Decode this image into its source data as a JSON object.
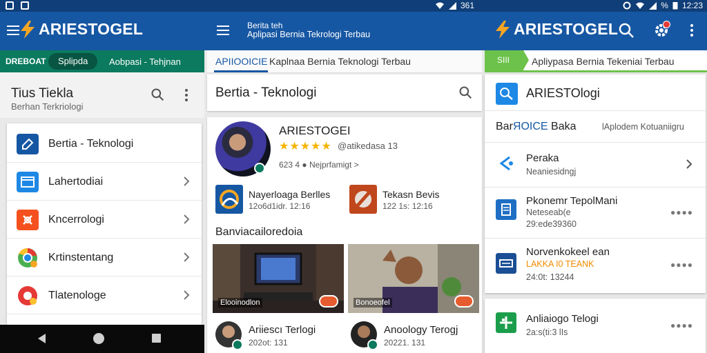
{
  "status": {
    "mid_text": "361",
    "right_text": "%",
    "time": "12:23"
  },
  "appbar": {
    "logo_left": "ARIESTOGEL",
    "logo_right": "ARIESTOGEL",
    "center_line1": "Berita teh",
    "center_line2": "Aplipasi Bernia Tekrologi Terbau"
  },
  "panel1": {
    "chips": [
      "DREBOAT",
      "Splipda",
      "Aobpasi - Tehjnan"
    ],
    "header_title": "Tius Tiekla",
    "header_subtitle": "Berhan Terkriologi",
    "items": [
      {
        "label": "Bertia - Teknologi",
        "icon": "edit-icon",
        "color": "#1657a3"
      },
      {
        "label": "Lahertodiai",
        "icon": "window-icon",
        "color": "#1e88e5"
      },
      {
        "label": "Kncerrologi",
        "icon": "tools-icon",
        "color": "#f4511e"
      },
      {
        "label": "Krtinstentang",
        "icon": "chrome-icon",
        "color": "#4caf50"
      },
      {
        "label": "Tlatenologe",
        "icon": "record-icon",
        "color": "#e53935"
      }
    ]
  },
  "panel2": {
    "tabs": [
      "APIIOOICIE",
      "Kaplnaa Bernia Teknologi Terbau"
    ],
    "search_title": "Bertia - Teknologi",
    "profile": {
      "name": "ARIESTOGEI",
      "rating_stars": "★★★★★",
      "rating": 5,
      "handle": "@atikedasa 13",
      "stats": "623 4 ● Nejprfamigt >"
    },
    "mini_items": [
      {
        "title": "Nayerloaga Berlles",
        "date": "12o6d1idr. 12:16"
      },
      {
        "title": "Tekasn Bevis",
        "date": "122 1s: 12:16"
      }
    ],
    "section_title": "Banviacailoredoia",
    "videos": [
      {
        "label": "Elooinodlon",
        "author": "Ariiescı Terlogi",
        "date": "202ot: 131"
      },
      {
        "label": "Bonoeofel",
        "author": "Anoology Terogj",
        "date": "20221. 131"
      }
    ]
  },
  "panel3": {
    "chips": [
      "SIII",
      "Apliypasa Bernia Tekeniai Terbau"
    ],
    "head_title": "ARIESTOlogi",
    "sub_left_a": "Bar",
    "sub_left_b": "ЯOICE",
    "sub_left_c": " Baka",
    "sub_right": "lAplodem Kotuaniigru",
    "items": [
      {
        "title": "Peraka",
        "desc": "Neaniesidngj",
        "extra": ""
      },
      {
        "title": "Pkonemr TepolMani",
        "desc": "Neteseab(e",
        "extra": "29:ede39360"
      },
      {
        "title": "Norvenkokeel ean",
        "desc": "LAKKA I0 TEANK",
        "extra": "24:0t: 13244"
      },
      {
        "title": "Anliaiogo Telogi",
        "desc": "2a:s(ti:3 lIs",
        "extra": ""
      }
    ],
    "dots": "●●●●"
  }
}
